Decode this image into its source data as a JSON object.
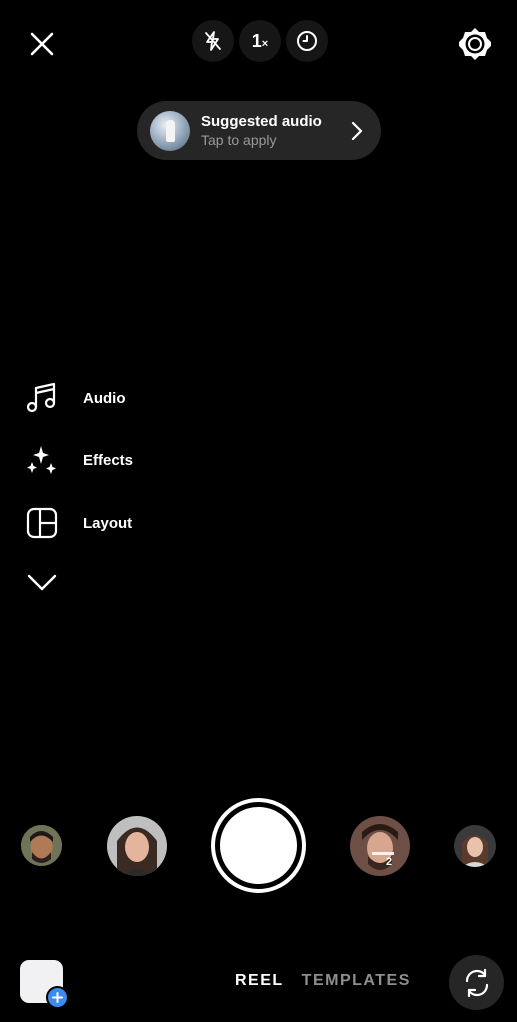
{
  "top_bar": {
    "close_icon": "close-icon",
    "flash_icon": "flash-off-icon",
    "zoom_value": "1",
    "zoom_suffix": "×",
    "timer_icon": "timer-icon",
    "settings_icon": "gear-icon"
  },
  "suggested_audio": {
    "title": "Suggested audio",
    "subtitle": "Tap to apply",
    "chevron_icon": "chevron-right-icon"
  },
  "side_menu": {
    "items": [
      {
        "label": "Audio",
        "icon": "music-note-icon"
      },
      {
        "label": "Effects",
        "icon": "sparkles-icon"
      },
      {
        "label": "Layout",
        "icon": "layout-grid-icon"
      }
    ],
    "more_icon": "chevron-down-icon"
  },
  "effects_carousel": {
    "badge_text": "2"
  },
  "bottom_bar": {
    "tabs": [
      {
        "label": "REEL",
        "active": true
      },
      {
        "label": "TEMPLATES",
        "active": false
      }
    ],
    "gallery_icon": "gallery-thumbnail",
    "flip_icon": "camera-flip-icon"
  },
  "colors": {
    "background": "#000000",
    "pill": "#262626",
    "inactive_text": "#8e8e8e",
    "accent_blue": "#3a8cf0"
  }
}
